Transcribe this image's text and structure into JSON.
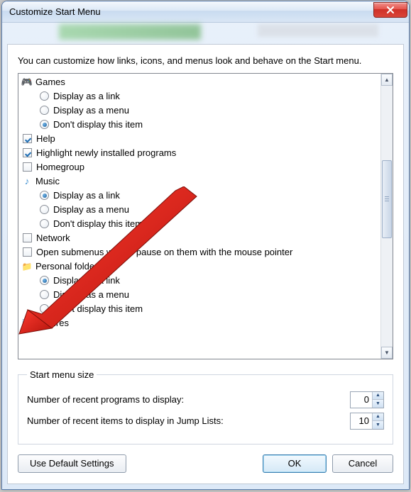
{
  "window": {
    "title": "Customize Start Menu"
  },
  "intro": "You can customize how links, icons, and menus look and behave on the Start menu.",
  "tree": {
    "games": {
      "label": "Games",
      "opt_link": "Display as a link",
      "opt_menu": "Display as a menu",
      "opt_none": "Don't display this item"
    },
    "help": "Help",
    "highlight": "Highlight newly installed programs",
    "homegroup": "Homegroup",
    "music": {
      "label": "Music",
      "opt_link": "Display as a link",
      "opt_menu": "Display as a menu",
      "opt_none": "Don't display this item"
    },
    "network": "Network",
    "open_submenus": "Open submenus when I pause on them with the mouse pointer",
    "personal": {
      "label": "Personal folder",
      "opt_link": "Display as a link",
      "opt_menu": "Display as a menu",
      "opt_none": "Don't display this item"
    },
    "pictures": "Pictures"
  },
  "size_group": {
    "legend": "Start menu size",
    "recent_programs_label": "Number of recent programs to display:",
    "recent_programs_value": "0",
    "jump_lists_label": "Number of recent items to display in Jump Lists:",
    "jump_lists_value": "10"
  },
  "buttons": {
    "defaults": "Use Default Settings",
    "ok": "OK",
    "cancel": "Cancel"
  }
}
